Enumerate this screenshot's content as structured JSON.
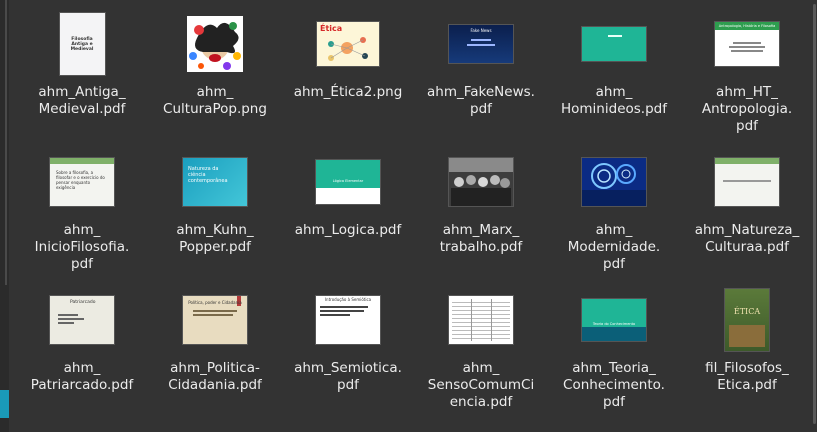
{
  "files": [
    {
      "name": "ahm_Antiga_\nMedieval.pdf",
      "thumb": "antiga",
      "thumb_text": "Filosofia\nAntiga e Medieval"
    },
    {
      "name": "ahm_\nCulturaPop.png",
      "thumb": "cultura"
    },
    {
      "name": "ahm_Ética2.png",
      "thumb": "etica2",
      "thumb_text": "Ética"
    },
    {
      "name": "ahm_FakeNews.\npdf",
      "thumb": "fakenews",
      "thumb_text": "Fake News"
    },
    {
      "name": "ahm_\nHominideos.pdf",
      "thumb": "hominideos"
    },
    {
      "name": "ahm_HT_\nAntropologia.\npdf",
      "thumb": "antropologia",
      "thumb_text": "Antropologia, História e Filosofia"
    },
    {
      "name": "ahm_\nInicioFilosofia.\npdf",
      "thumb": "inicio",
      "thumb_text": "Sobre a filosofia, a filosofar e o exercício do pensar enquanto exigência"
    },
    {
      "name": "ahm_Kuhn_\nPopper.pdf",
      "thumb": "kuhn",
      "thumb_text": "Natureza da ciência contemporânea"
    },
    {
      "name": "ahm_Logica.pdf",
      "thumb": "logica",
      "thumb_text": "Lógica Elementar"
    },
    {
      "name": "ahm_Marx_\ntrabalho.pdf",
      "thumb": "marx"
    },
    {
      "name": "ahm_\nModernidade.\npdf",
      "thumb": "modernidade"
    },
    {
      "name": "ahm_Natureza_\nCulturaa.pdf",
      "thumb": "natureza"
    },
    {
      "name": "ahm_\nPatriarcado.pdf",
      "thumb": "patriarcado",
      "thumb_text": "Patriarcado"
    },
    {
      "name": "ahm_Politica-\nCidadania.pdf",
      "thumb": "politica",
      "thumb_text": "Política, poder e Cidadania"
    },
    {
      "name": "ahm_Semiotica.\npdf",
      "thumb": "semiotica",
      "thumb_text": "Introdução à Semiótica"
    },
    {
      "name": "ahm_\nSensoComumCi\nencia.pdf",
      "thumb": "senso"
    },
    {
      "name": "ahm_Teoria_\nConhecimento.\npdf",
      "thumb": "teoria",
      "thumb_text": "Teoria do Conhecimento"
    },
    {
      "name": "fil_Filosofos_\nEtica.pdf",
      "thumb": "filosofos",
      "thumb_text": "ÉTICA"
    }
  ],
  "colors": {
    "background": "#333333",
    "label": "#ececec",
    "teal": "#1fb596",
    "sidebar_accent": "#1a9ab8"
  }
}
